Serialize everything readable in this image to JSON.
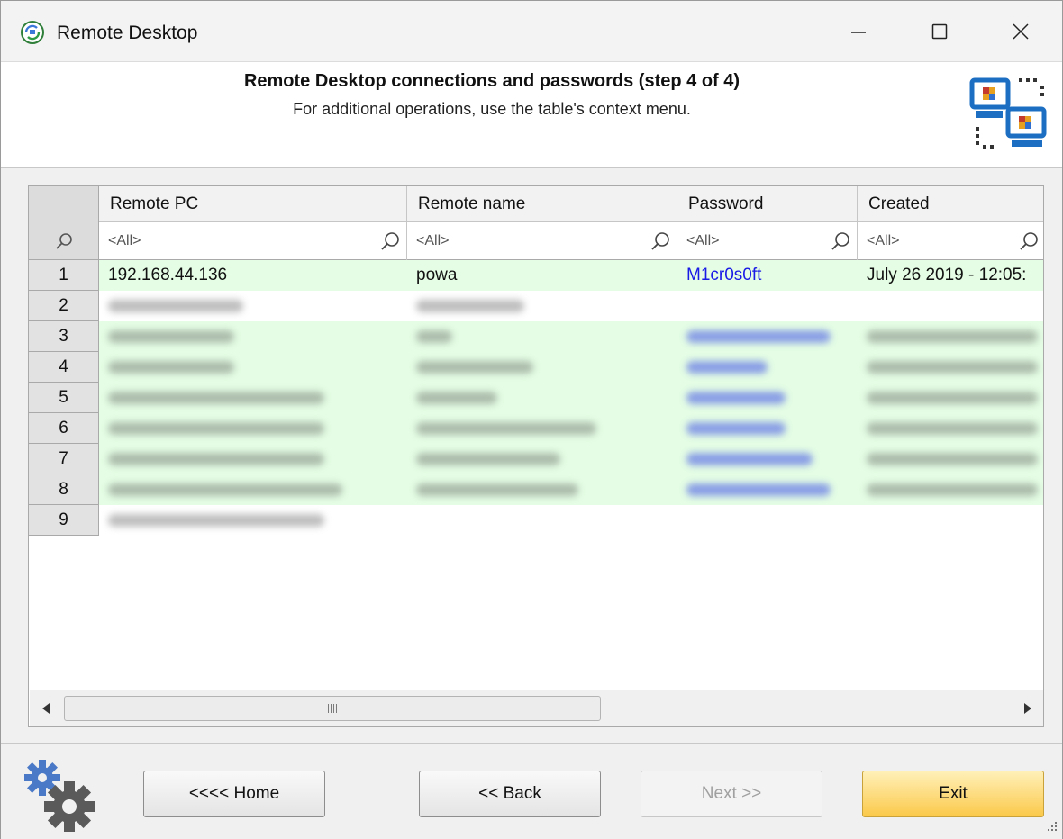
{
  "window": {
    "title": "Remote Desktop",
    "icon": "remote-desktop-app-icon"
  },
  "header": {
    "title": "Remote Desktop connections and passwords (step 4 of 4)",
    "subtitle": "For additional operations, use the table's context menu.",
    "icon": "two-computers-network-icon"
  },
  "table": {
    "columns": [
      "Remote PC",
      "Remote name",
      "Password",
      "Created"
    ],
    "filter_placeholder": "<All>",
    "rows": [
      {
        "num": "1",
        "remote_pc": "192.168.44.136",
        "remote_name": "powa",
        "password": "M1cr0s0ft",
        "created": "July 26 2019 - 12:05:"
      },
      {
        "num": "2"
      },
      {
        "num": "3"
      },
      {
        "num": "4"
      },
      {
        "num": "5"
      },
      {
        "num": "6"
      },
      {
        "num": "7"
      },
      {
        "num": "8"
      },
      {
        "num": "9"
      }
    ],
    "row_highlight_color": "#e4fde4",
    "password_color": "#1a1ae6"
  },
  "footer": {
    "home_label": "<<<< Home",
    "back_label": "<< Back",
    "next_label": "Next >>",
    "exit_label": "Exit",
    "icon": "gears-icon"
  }
}
